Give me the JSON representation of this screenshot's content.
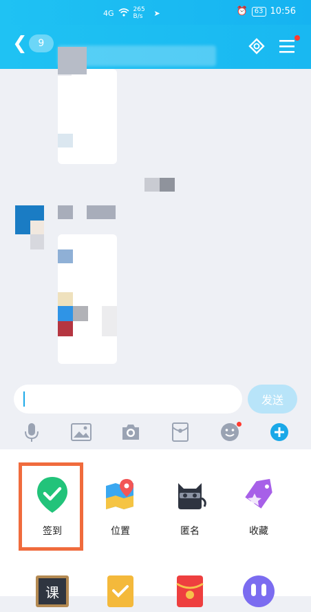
{
  "status": {
    "network": "4G",
    "speed": "265 B/s",
    "battery": "63",
    "time": "10:56"
  },
  "header": {
    "unread_count": "9"
  },
  "input": {
    "placeholder": "",
    "send_label": "发送"
  },
  "toolbar": {
    "icons": [
      "microphone-icon",
      "image-icon",
      "camera-icon",
      "red-packet-icon",
      "emoji-icon",
      "plus-icon"
    ]
  },
  "panel": {
    "row1": [
      {
        "label": "签到",
        "icon": "checkin-icon"
      },
      {
        "label": "位置",
        "icon": "location-icon"
      },
      {
        "label": "匿名",
        "icon": "anonymous-icon"
      },
      {
        "label": "收藏",
        "icon": "favorite-icon"
      }
    ],
    "row2": [
      {
        "label": "课",
        "icon": "course-icon"
      },
      {
        "label": "",
        "icon": "task-icon"
      },
      {
        "label": "",
        "icon": "red-envelope-icon"
      },
      {
        "label": "",
        "icon": "earphone-icon"
      }
    ]
  },
  "colors": {
    "accent": "#1fc2f3",
    "highlight": "#f06b3d",
    "checkin_green": "#22c37a"
  }
}
